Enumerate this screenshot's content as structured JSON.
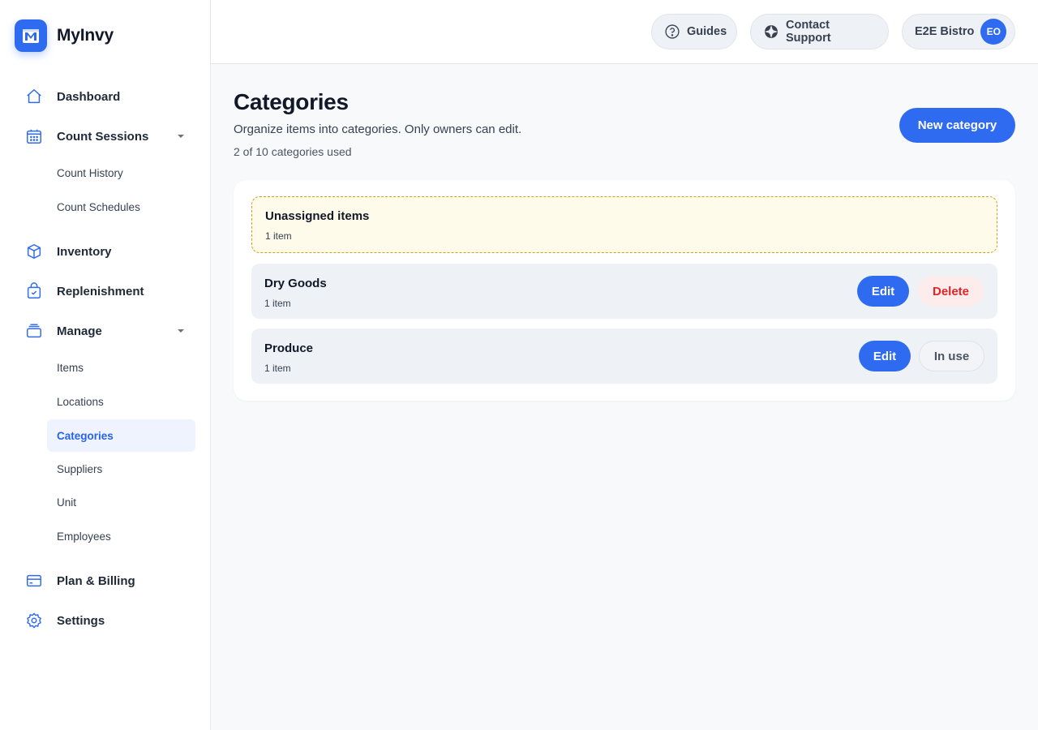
{
  "brand": {
    "name": "MyInvy"
  },
  "sidebar": {
    "items": [
      {
        "label": "Dashboard",
        "icon": "home-icon"
      },
      {
        "label": "Count Sessions",
        "icon": "calendar-icon",
        "expanded": true,
        "children": [
          {
            "label": "Count History"
          },
          {
            "label": "Count Schedules"
          }
        ]
      },
      {
        "label": "Inventory",
        "icon": "box-icon"
      },
      {
        "label": "Replenishment",
        "icon": "shopping-bag-icon"
      },
      {
        "label": "Manage",
        "icon": "layers-icon",
        "expanded": true,
        "children": [
          {
            "label": "Items"
          },
          {
            "label": "Locations"
          },
          {
            "label": "Categories",
            "active": true
          },
          {
            "label": "Suppliers"
          },
          {
            "label": "Unit"
          },
          {
            "label": "Employees"
          }
        ]
      },
      {
        "label": "Plan & Billing",
        "icon": "credit-card-icon"
      },
      {
        "label": "Settings",
        "icon": "gear-icon"
      }
    ]
  },
  "header": {
    "guides_label": "Guides",
    "support_label": "Contact Support",
    "account_name": "E2E Bistro",
    "avatar_initials": "EO"
  },
  "main": {
    "title": "Categories",
    "subtitle": "Organize items into categories. Only owners can edit.",
    "usage": "2 of 10 categories used",
    "new_button": "New category",
    "unassigned": {
      "name": "Unassigned items",
      "count": "1 item"
    },
    "categories": [
      {
        "name": "Dry Goods",
        "count": "1 item",
        "edit_label": "Edit",
        "secondary_label": "Delete",
        "secondary_type": "delete"
      },
      {
        "name": "Produce",
        "count": "1 item",
        "edit_label": "Edit",
        "secondary_label": "In use",
        "secondary_type": "in-use"
      }
    ]
  },
  "colors": {
    "accent": "#2f6bf0",
    "active_bg": "#eef3fd",
    "danger": "#dc2626",
    "warning_border": "#d4a017",
    "warning_bg": "#fefbea"
  }
}
